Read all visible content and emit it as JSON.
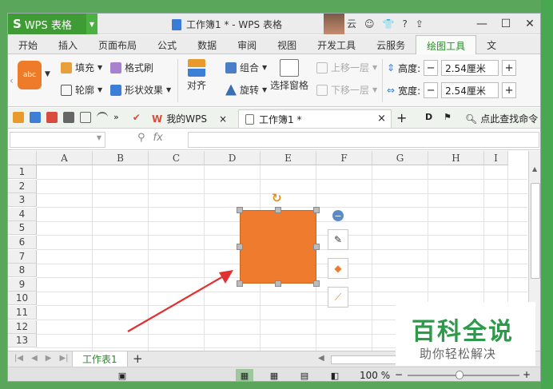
{
  "title_bar": {
    "app_name": "WPS 表格",
    "doc_title": "工作簿1 * - WPS 表格",
    "user_label": "云",
    "help": "?"
  },
  "menu_tabs": [
    "开始",
    "插入",
    "页面布局",
    "公式",
    "数据",
    "审阅",
    "视图",
    "开发工具",
    "云服务",
    "绘图工具",
    "文"
  ],
  "active_tab": "绘图工具",
  "ribbon": {
    "shape_preview": "abc",
    "fill": "填充",
    "format_painter": "格式刷",
    "outline": "轮廓",
    "shape_effect": "形状效果",
    "align": "对齐",
    "group": "组合",
    "rotate": "旋转",
    "selection_pane": "选择窗格",
    "bring_forward": "上移一层",
    "send_backward": "下移一层",
    "height_label": "高度:",
    "height_value": "2.54厘米",
    "width_label": "宽度:",
    "width_value": "2.54厘米"
  },
  "quickbar": {
    "my_wps": "我的WPS",
    "book_tab": "工作簿1 *",
    "search": "点此查找命令"
  },
  "formula_bar": {
    "fx": "fx"
  },
  "grid": {
    "columns": [
      "A",
      "B",
      "C",
      "D",
      "E",
      "F",
      "G",
      "H",
      "I"
    ],
    "rows": [
      "1",
      "2",
      "3",
      "4",
      "5",
      "6",
      "7",
      "8",
      "9",
      "10",
      "11",
      "12",
      "13"
    ]
  },
  "sheet_tab": "工作表1",
  "status": {
    "zoom": "100 %"
  },
  "watermark": {
    "title": "百科全说",
    "subtitle": "助你轻松解决"
  },
  "colors": {
    "accent": "#3f9c35",
    "shape_fill": "#ee7b2e",
    "arrow": "#e03030"
  }
}
